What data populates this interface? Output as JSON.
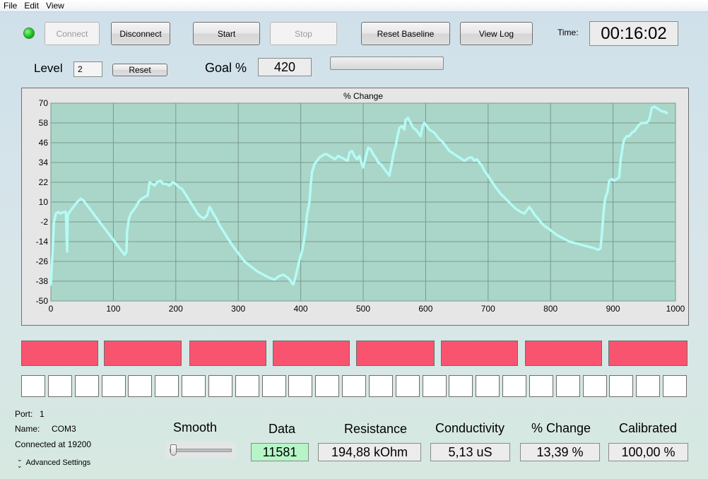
{
  "menu": [
    "File",
    "Edit",
    "View"
  ],
  "toolbar": {
    "connect": "Connect",
    "disconnect": "Disconnect",
    "start": "Start",
    "stop": "Stop",
    "reset_baseline": "Reset Baseline",
    "view_log": "View Log",
    "time_label": "Time:",
    "time_value": "00:16:02",
    "status_led_color": "#19c419"
  },
  "level": {
    "label": "Level",
    "value": "2",
    "reset": "Reset"
  },
  "goal": {
    "label": "Goal %",
    "value": "420",
    "progress": 0
  },
  "chart_data": {
    "type": "line",
    "title": "% Change",
    "xlim": [
      0,
      1000
    ],
    "ylim": [
      -50,
      70
    ],
    "x_ticks": [
      0,
      100,
      200,
      300,
      400,
      500,
      600,
      700,
      800,
      900,
      1000
    ],
    "y_ticks": [
      -50,
      -38,
      -26,
      -14,
      -2,
      10,
      22,
      34,
      46,
      58,
      70
    ],
    "grid": true,
    "series_color": "#b5fbf6",
    "plot_bg": "#a9d6c8",
    "points": [
      [
        0,
        -40
      ],
      [
        3,
        -18
      ],
      [
        5,
        -2
      ],
      [
        8,
        3
      ],
      [
        12,
        4
      ],
      [
        15,
        3
      ],
      [
        20,
        4
      ],
      [
        24,
        4
      ],
      [
        26,
        -20
      ],
      [
        27,
        2
      ],
      [
        30,
        4
      ],
      [
        34,
        6
      ],
      [
        38,
        8
      ],
      [
        42,
        10
      ],
      [
        45,
        11
      ],
      [
        48,
        12
      ],
      [
        52,
        11
      ],
      [
        56,
        9
      ],
      [
        62,
        6
      ],
      [
        70,
        2
      ],
      [
        80,
        -3
      ],
      [
        90,
        -8
      ],
      [
        100,
        -13
      ],
      [
        110,
        -18
      ],
      [
        118,
        -22
      ],
      [
        121,
        -20
      ],
      [
        122,
        -8
      ],
      [
        125,
        0
      ],
      [
        128,
        3
      ],
      [
        132,
        5
      ],
      [
        136,
        7
      ],
      [
        140,
        10
      ],
      [
        145,
        12
      ],
      [
        150,
        13
      ],
      [
        155,
        14
      ],
      [
        158,
        22
      ],
      [
        162,
        21
      ],
      [
        166,
        20
      ],
      [
        170,
        22
      ],
      [
        175,
        23
      ],
      [
        180,
        21
      ],
      [
        185,
        21
      ],
      [
        190,
        20
      ],
      [
        195,
        22
      ],
      [
        200,
        21
      ],
      [
        205,
        19
      ],
      [
        210,
        18
      ],
      [
        215,
        15
      ],
      [
        220,
        12
      ],
      [
        225,
        9
      ],
      [
        230,
        6
      ],
      [
        235,
        3
      ],
      [
        240,
        1
      ],
      [
        245,
        0
      ],
      [
        250,
        2
      ],
      [
        254,
        7
      ],
      [
        256,
        6
      ],
      [
        260,
        3
      ],
      [
        265,
        0
      ],
      [
        270,
        -4
      ],
      [
        280,
        -10
      ],
      [
        290,
        -16
      ],
      [
        300,
        -21
      ],
      [
        310,
        -26
      ],
      [
        320,
        -29
      ],
      [
        330,
        -32
      ],
      [
        340,
        -34
      ],
      [
        350,
        -36
      ],
      [
        358,
        -37
      ],
      [
        365,
        -35
      ],
      [
        372,
        -34
      ],
      [
        380,
        -36
      ],
      [
        386,
        -39
      ],
      [
        388,
        -40
      ],
      [
        392,
        -35
      ],
      [
        395,
        -30
      ],
      [
        398,
        -25
      ],
      [
        402,
        -20
      ],
      [
        405,
        -14
      ],
      [
        408,
        -6
      ],
      [
        410,
        2
      ],
      [
        414,
        10
      ],
      [
        416,
        20
      ],
      [
        418,
        28
      ],
      [
        422,
        33
      ],
      [
        426,
        35
      ],
      [
        430,
        37
      ],
      [
        434,
        38
      ],
      [
        438,
        39
      ],
      [
        442,
        39
      ],
      [
        446,
        38
      ],
      [
        450,
        37
      ],
      [
        455,
        36
      ],
      [
        460,
        38
      ],
      [
        465,
        37
      ],
      [
        470,
        36
      ],
      [
        475,
        35
      ],
      [
        478,
        40
      ],
      [
        482,
        41
      ],
      [
        486,
        38
      ],
      [
        490,
        36
      ],
      [
        494,
        38
      ],
      [
        497,
        34
      ],
      [
        500,
        31
      ],
      [
        504,
        37
      ],
      [
        508,
        43
      ],
      [
        512,
        42
      ],
      [
        516,
        39
      ],
      [
        520,
        37
      ],
      [
        524,
        34
      ],
      [
        528,
        33
      ],
      [
        532,
        31
      ],
      [
        536,
        29
      ],
      [
        540,
        27
      ],
      [
        542,
        26
      ],
      [
        546,
        34
      ],
      [
        549,
        40
      ],
      [
        552,
        44
      ],
      [
        555,
        50
      ],
      [
        558,
        55
      ],
      [
        562,
        56
      ],
      [
        566,
        54
      ],
      [
        568,
        60
      ],
      [
        572,
        61
      ],
      [
        576,
        58
      ],
      [
        580,
        55
      ],
      [
        584,
        54
      ],
      [
        588,
        52
      ],
      [
        592,
        50
      ],
      [
        595,
        56
      ],
      [
        598,
        58
      ],
      [
        602,
        56
      ],
      [
        606,
        54
      ],
      [
        610,
        53
      ],
      [
        614,
        52
      ],
      [
        618,
        50
      ],
      [
        622,
        48
      ],
      [
        626,
        47
      ],
      [
        630,
        45
      ],
      [
        634,
        43
      ],
      [
        638,
        41
      ],
      [
        642,
        40
      ],
      [
        646,
        39
      ],
      [
        650,
        38
      ],
      [
        654,
        37
      ],
      [
        658,
        36
      ],
      [
        662,
        35
      ],
      [
        666,
        36
      ],
      [
        670,
        37
      ],
      [
        674,
        37
      ],
      [
        678,
        35
      ],
      [
        682,
        36
      ],
      [
        686,
        34
      ],
      [
        690,
        32
      ],
      [
        694,
        29
      ],
      [
        698,
        27
      ],
      [
        705,
        23
      ],
      [
        712,
        19
      ],
      [
        720,
        15
      ],
      [
        728,
        12
      ],
      [
        736,
        9
      ],
      [
        744,
        6
      ],
      [
        752,
        4
      ],
      [
        758,
        3
      ],
      [
        762,
        5
      ],
      [
        766,
        7
      ],
      [
        770,
        5
      ],
      [
        775,
        2
      ],
      [
        780,
        0
      ],
      [
        786,
        -3
      ],
      [
        792,
        -5
      ],
      [
        800,
        -7
      ],
      [
        810,
        -10
      ],
      [
        820,
        -12
      ],
      [
        830,
        -14
      ],
      [
        840,
        -15
      ],
      [
        850,
        -16
      ],
      [
        860,
        -17
      ],
      [
        870,
        -18
      ],
      [
        876,
        -19
      ],
      [
        880,
        -18
      ],
      [
        882,
        -10
      ],
      [
        884,
        0
      ],
      [
        886,
        8
      ],
      [
        888,
        13
      ],
      [
        891,
        16
      ],
      [
        894,
        23
      ],
      [
        898,
        24
      ],
      [
        902,
        23
      ],
      [
        906,
        24
      ],
      [
        910,
        25
      ],
      [
        912,
        35
      ],
      [
        914,
        40
      ],
      [
        916,
        45
      ],
      [
        918,
        48
      ],
      [
        922,
        50
      ],
      [
        926,
        50
      ],
      [
        930,
        52
      ],
      [
        934,
        53
      ],
      [
        938,
        55
      ],
      [
        942,
        57
      ],
      [
        946,
        58
      ],
      [
        950,
        58
      ],
      [
        954,
        58
      ],
      [
        958,
        60
      ],
      [
        962,
        67
      ],
      [
        966,
        68
      ],
      [
        970,
        67
      ],
      [
        974,
        66
      ],
      [
        978,
        65
      ],
      [
        982,
        65
      ],
      [
        986,
        64
      ]
    ]
  },
  "segments_red_count": 8,
  "segments_white_count": 25,
  "port": {
    "port_label": "Port:",
    "port_value": "1",
    "name_label": "Name:",
    "name_value": "COM3",
    "connected": "Connected at 19200",
    "advanced": "Advanced Settings"
  },
  "smooth": {
    "label": "Smooth",
    "value": 0
  },
  "readouts": [
    {
      "label": "Data",
      "value": "11581"
    },
    {
      "label": "Resistance",
      "value": "194,88 kOhm"
    },
    {
      "label": "Conductivity",
      "value": "5,13 uS"
    },
    {
      "label": "% Change",
      "value": "13,39 %"
    },
    {
      "label": "Calibrated",
      "value": "100,00 %"
    }
  ]
}
